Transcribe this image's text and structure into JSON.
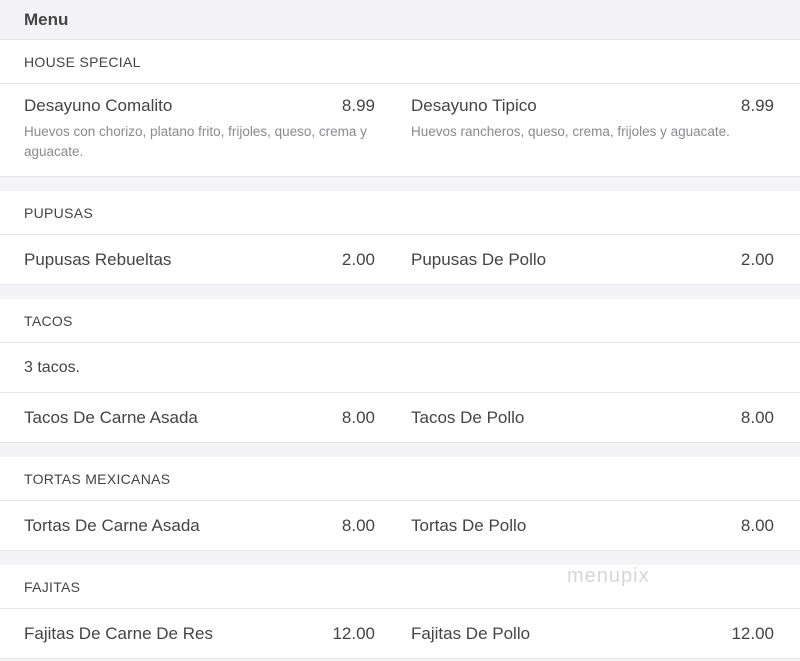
{
  "header": {
    "title": "Menu"
  },
  "watermark": "menupix",
  "sections": [
    {
      "title": "HOUSE SPECIAL",
      "items": [
        {
          "name": "Desayuno Comalito",
          "price": "8.99",
          "desc": "Huevos con chorizo, platano frito, frijoles, queso, crema y aguacate."
        },
        {
          "name": "Desayuno Tipico",
          "price": "8.99",
          "desc": "Huevos rancheros, queso, crema, frijoles y aguacate."
        }
      ]
    },
    {
      "title": "PUPUSAS",
      "items": [
        {
          "name": "Pupusas Rebueltas",
          "price": "2.00"
        },
        {
          "name": "Pupusas De Pollo",
          "price": "2.00"
        }
      ]
    },
    {
      "title": "TACOS",
      "note": "3 tacos.",
      "items": [
        {
          "name": "Tacos De Carne Asada",
          "price": "8.00"
        },
        {
          "name": "Tacos De Pollo",
          "price": "8.00"
        }
      ]
    },
    {
      "title": "TORTAS MEXICANAS",
      "items": [
        {
          "name": "Tortas De Carne Asada",
          "price": "8.00"
        },
        {
          "name": "Tortas De Pollo",
          "price": "8.00"
        }
      ]
    },
    {
      "title": "FAJITAS",
      "items": [
        {
          "name": "Fajitas De Carne De Res",
          "price": "12.00"
        },
        {
          "name": "Fajitas De Pollo",
          "price": "12.00"
        }
      ]
    }
  ]
}
